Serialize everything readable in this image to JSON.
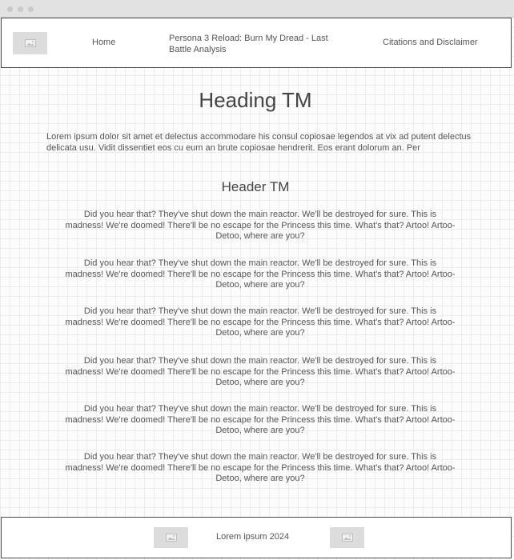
{
  "header": {
    "logo_icon": "image-placeholder-icon",
    "nav": {
      "home": "Home",
      "title": "Persona 3 Reload: Burn My Dread - Last Battle Analysis",
      "citations": "Citations and Disclaimer"
    }
  },
  "main": {
    "heading": "Heading TM",
    "intro": "Lorem ipsum dolor sit amet et delectus accommodare his consul copiosae legendos at vix ad putent delectus delicata usu. Vidit dissentiet eos cu eum an brute copiosae hendrerit. Eos erant dolorum an. Per",
    "subheader": "Header TM",
    "paragraphs": [
      "Did you hear that? They've shut down the main reactor. We'll be destroyed for sure. This is madness! We're doomed! There'll be no escape for the Princess this time. What's that? Artoo! Artoo-Detoo, where are you?",
      "Did you hear that? They've shut down the main reactor. We'll be destroyed for sure. This is madness! We're doomed! There'll be no escape for the Princess this time. What's that? Artoo! Artoo-Detoo, where are you?",
      "Did you hear that? They've shut down the main reactor. We'll be destroyed for sure. This is madness! We're doomed! There'll be no escape for the Princess this time. What's that? Artoo! Artoo-Detoo, where are you?",
      "Did you hear that? They've shut down the main reactor. We'll be destroyed for sure. This is madness! We're doomed! There'll be no escape for the Princess this time. What's that? Artoo! Artoo-Detoo, where are you?",
      "Did you hear that? They've shut down the main reactor. We'll be destroyed for sure. This is madness! We're doomed! There'll be no escape for the Princess this time. What's that? Artoo! Artoo-Detoo, where are you?",
      "Did you hear that? They've shut down the main reactor. We'll be destroyed for sure. This is madness! We're doomed! There'll be no escape for the Princess this time. What's that? Artoo! Artoo-Detoo, where are you?"
    ]
  },
  "footer": {
    "text": "Lorem ipsum 2024",
    "left_icon": "image-placeholder-icon",
    "right_icon": "image-placeholder-icon"
  }
}
